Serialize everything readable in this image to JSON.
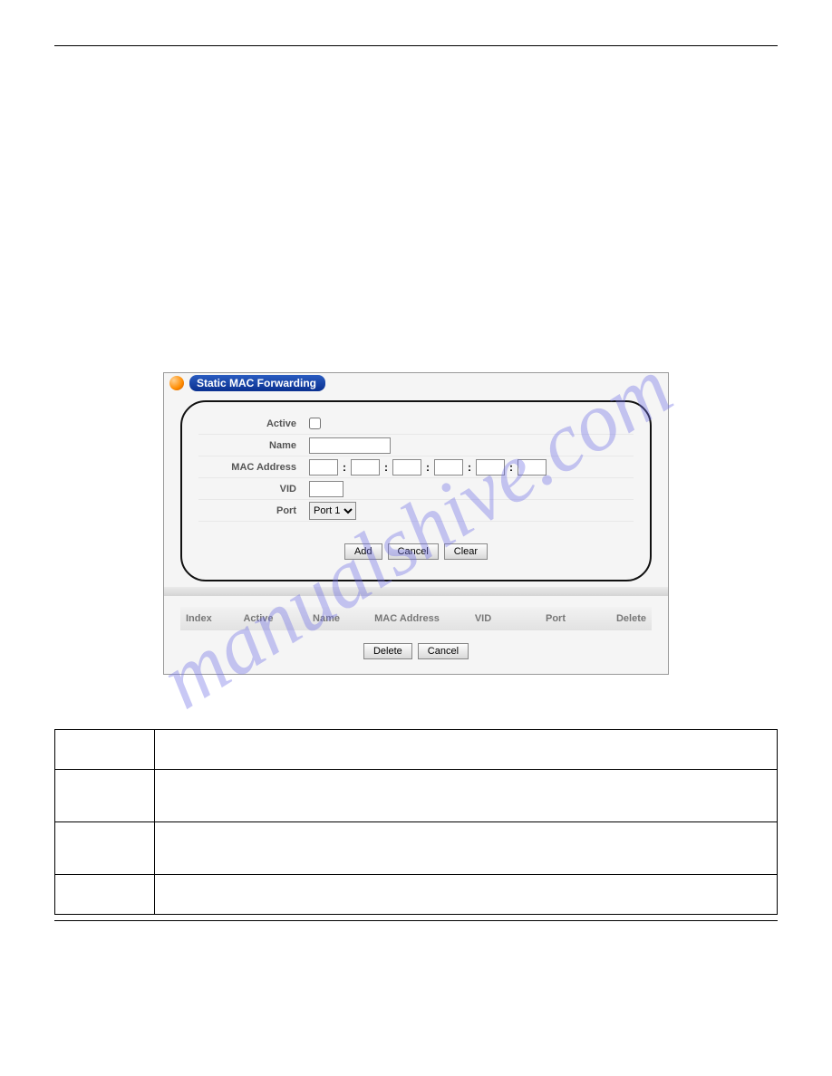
{
  "watermark": "manualshive.com",
  "panel": {
    "title": "Static MAC Forwarding",
    "form": {
      "labels": {
        "active": "Active",
        "name": "Name",
        "mac": "MAC Address",
        "vid": "VID",
        "port": "Port"
      },
      "values": {
        "name": "",
        "mac": [
          "",
          "",
          "",
          "",
          "",
          ""
        ],
        "vid": "",
        "port_selected": "Port 1"
      },
      "mac_sep": ":",
      "port_options": [
        "Port 1"
      ]
    },
    "buttons": {
      "add": "Add",
      "cancel": "Cancel",
      "clear": "Clear"
    },
    "table_headers": {
      "index": "Index",
      "active": "Active",
      "name": "Name",
      "mac": "MAC Address",
      "vid": "VID",
      "port": "Port",
      "delete": "Delete"
    },
    "bottom_buttons": {
      "delete": "Delete",
      "cancel": "Cancel"
    }
  }
}
